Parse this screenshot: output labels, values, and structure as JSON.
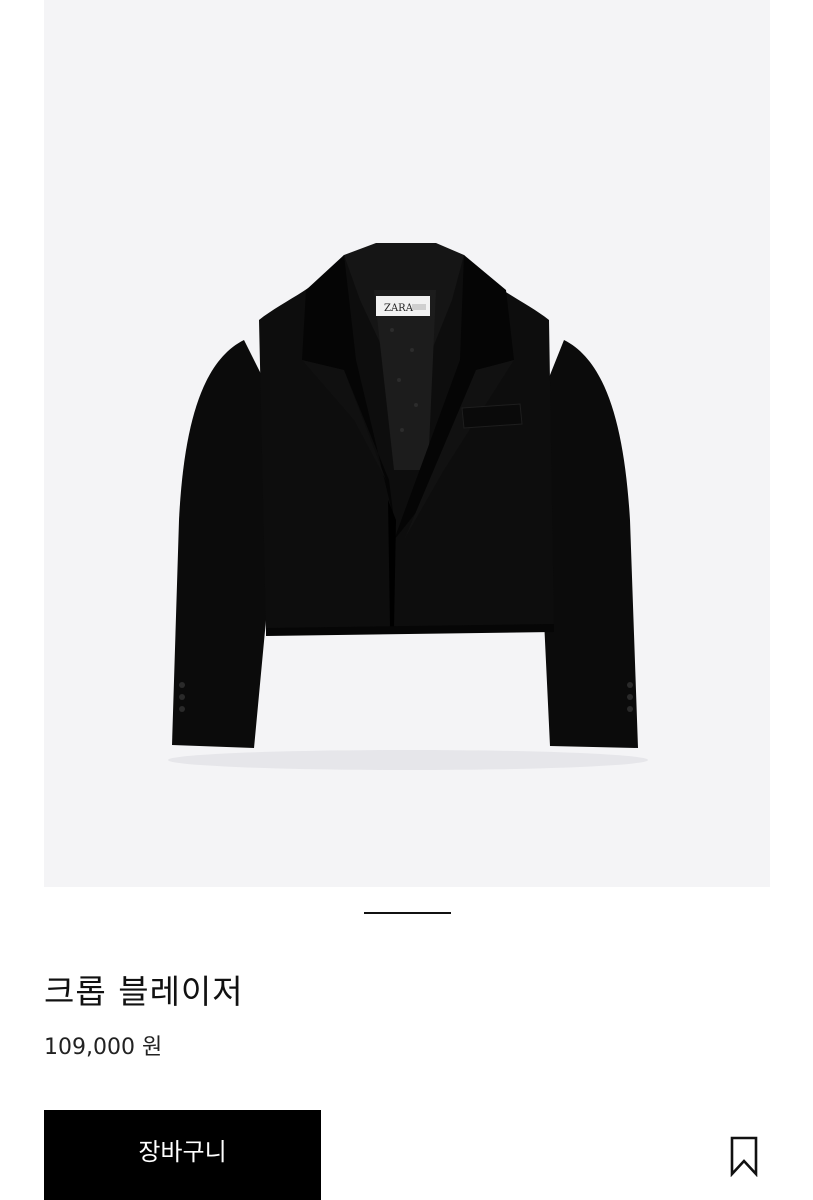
{
  "product": {
    "name": "크롭 블레이저",
    "price": "109,000 원",
    "image_description": "black cropped blazer product photo",
    "image_background": "#f4f4f6",
    "label_text": "ZARA"
  },
  "gallery": {
    "indicator_color": "#111111"
  },
  "actions": {
    "add_to_cart_label": "장바구니",
    "bookmark_icon": "bookmark-icon"
  }
}
